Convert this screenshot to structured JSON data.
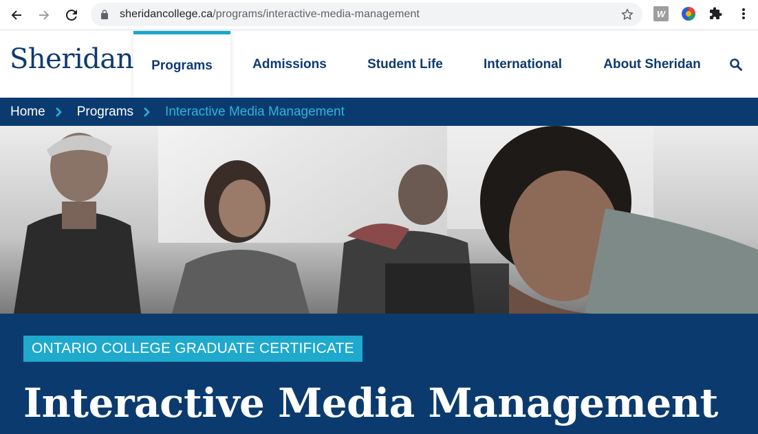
{
  "browser": {
    "url_domain": "sheridancollege.ca",
    "url_path": "/programs/interactive-media-management",
    "extension_w_label": "W"
  },
  "site": {
    "logo": "Sheridan",
    "nav": {
      "programs": "Programs",
      "admissions": "Admissions",
      "student_life": "Student Life",
      "international": "International",
      "about": "About Sheridan"
    },
    "active_nav": "Programs"
  },
  "breadcrumb": {
    "home": "Home",
    "programs": "Programs",
    "current": "Interactive Media Management"
  },
  "program": {
    "credential": "ONTARIO COLLEGE GRADUATE CERTIFICATE",
    "title": "Interactive Media Management"
  },
  "colors": {
    "brand_navy": "#0b3b6e",
    "accent_teal": "#1fa9cd",
    "breadcrumb_current": "#2ab6d9"
  },
  "icons": {
    "back": "back-arrow-icon",
    "forward": "forward-arrow-icon",
    "reload": "reload-icon",
    "lock": "lock-icon",
    "star": "star-icon",
    "extension_w": "w-extension-icon",
    "extension_circle": "colorful-circle-extension-icon",
    "extensions": "puzzle-icon",
    "menu": "vertical-dots-menu-icon",
    "search": "search-icon",
    "breadcrumb_separator": "chevron-right-icon"
  }
}
